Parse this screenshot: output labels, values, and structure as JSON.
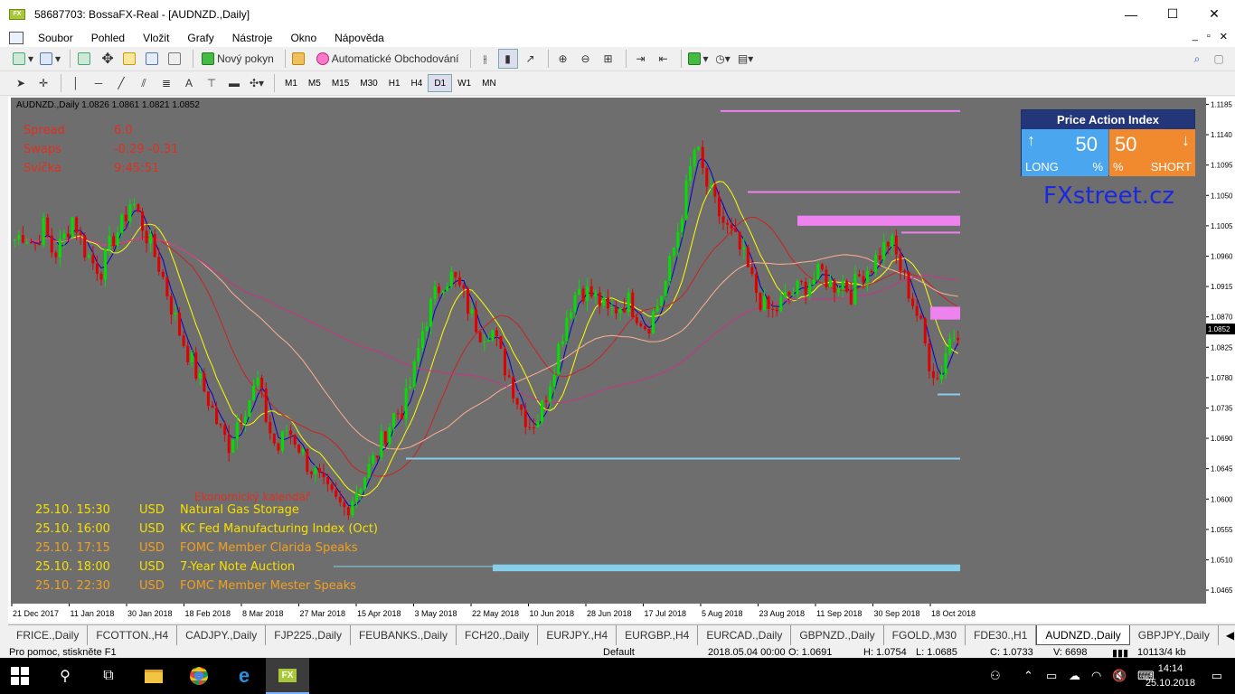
{
  "window": {
    "title": "58687703: BossaFX-Real - [AUDNZD.,Daily]",
    "icon_text": "FX",
    "minimize": "—",
    "maximize": "☐",
    "close": "✕"
  },
  "menu": {
    "items": [
      "Soubor",
      "Pohled",
      "Vložit",
      "Grafy",
      "Nástroje",
      "Okno",
      "Nápověda"
    ],
    "mdi_controls": [
      "_",
      "▫",
      "✕"
    ]
  },
  "toolbar1": {
    "new_order": "Nový pokyn",
    "auto_trading": "Automatické Obchodování"
  },
  "toolbar2": {
    "timeframes": [
      "M1",
      "M5",
      "M15",
      "M30",
      "H1",
      "H4",
      "D1",
      "W1",
      "MN"
    ],
    "active_timeframe": "D1",
    "text_tool": "A"
  },
  "chart": {
    "header": "AUDNZD.,Daily  1.0826 1.0861 1.0821 1.0852",
    "info": {
      "spread_label": "Spread",
      "spread_value": "6.0",
      "swaps_label": "Swaps",
      "swaps_value": "-0.29 -0.31",
      "candle_label": "Svíčka",
      "candle_value": "9:45:51"
    },
    "watermark": "FXstreet.cz",
    "pai": {
      "title": "Price Action Index",
      "long_value": "50",
      "long_label": "LONG",
      "short_value": "50",
      "short_label": "SHORT",
      "pct": "%"
    },
    "calendar": {
      "title": "Ekonomický kalendář",
      "rows": [
        {
          "time": "25.10. 15:30",
          "currency": "USD",
          "event": "Natural Gas Storage",
          "color": "#f5e000"
        },
        {
          "time": "25.10. 16:00",
          "currency": "USD",
          "event": "KC Fed Manufacturing Index (Oct)",
          "color": "#f5e000"
        },
        {
          "time": "25.10. 17:15",
          "currency": "USD",
          "event": "FOMC Member Clarida Speaks",
          "color": "#f0a020"
        },
        {
          "time": "25.10. 18:00",
          "currency": "USD",
          "event": "7-Year Note Auction",
          "color": "#f5e000"
        },
        {
          "time": "25.10. 22:30",
          "currency": "USD",
          "event": "FOMC Member Mester Speaks",
          "color": "#f0a020"
        }
      ]
    },
    "current_price": "1.0852"
  },
  "chart_data": {
    "type": "candlestick",
    "symbol": "AUDNZD.",
    "timeframe": "Daily",
    "ylim": [
      1.0445,
      1.1195
    ],
    "y_ticks": [
      "1.1185",
      "1.1140",
      "1.1095",
      "1.1050",
      "1.1005",
      "1.0960",
      "1.0915",
      "1.0870",
      "1.0825",
      "1.0780",
      "1.0735",
      "1.0690",
      "1.0645",
      "1.0600",
      "1.0555",
      "1.0510",
      "1.0465"
    ],
    "x_ticks": [
      "21 Dec 2017",
      "11 Jan 2018",
      "30 Jan 2018",
      "18 Feb 2018",
      "8 Mar 2018",
      "27 Mar 2018",
      "15 Apr 2018",
      "3 May 2018",
      "22 May 2018",
      "10 Jun 2018",
      "28 Jun 2018",
      "17 Jul 2018",
      "5 Aug 2018",
      "23 Aug 2018",
      "11 Sep 2018",
      "30 Sep 2018",
      "18 Oct 2018"
    ],
    "close_path": [
      1.0985,
      1.0995,
      1.0975,
      1.1005,
      1.096,
      1.0985,
      1.102,
      1.0975,
      1.095,
      1.094,
      1.0985,
      1.1005,
      1.1045,
      1.101,
      1.0975,
      1.094,
      1.089,
      1.0845,
      1.081,
      1.0775,
      1.0745,
      1.0705,
      1.068,
      1.072,
      1.0745,
      1.0775,
      1.071,
      1.067,
      1.0705,
      1.0685,
      1.0655,
      1.0635,
      1.061,
      1.0595,
      1.0585,
      1.061,
      1.0635,
      1.066,
      1.0695,
      1.0725,
      1.0735,
      1.0785,
      1.0855,
      1.0895,
      1.0925,
      1.093,
      1.0905,
      1.087,
      1.0845,
      1.0855,
      1.081,
      1.0775,
      1.0735,
      1.071,
      1.0725,
      1.0775,
      1.083,
      1.0885,
      1.0915,
      1.0905,
      1.0895,
      1.0875,
      1.0885,
      1.0895,
      1.0875,
      1.0855,
      1.0885,
      1.0925,
      1.0985,
      1.1055,
      1.1125,
      1.107,
      1.1035,
      1.1005,
      1.0985,
      1.0955,
      1.0915,
      1.0885,
      1.0875,
      1.0895,
      1.0905,
      1.0915,
      1.0925,
      1.0935,
      1.0915,
      1.0925,
      1.0905,
      1.0935,
      1.0945,
      1.0965,
      1.0985,
      1.0945,
      1.0905,
      1.0865,
      1.0805,
      1.0775,
      1.0835,
      1.0852
    ],
    "levels": [
      {
        "price": 1.1175,
        "color": "#ee82ee"
      },
      {
        "price": 1.1055,
        "color": "#ee82ee"
      },
      {
        "price": 1.0995,
        "color": "#ee82ee"
      },
      {
        "price": 1.0755,
        "color": "#87ceeb"
      },
      {
        "price": 1.066,
        "color": "#87ceeb"
      }
    ],
    "zones": [
      {
        "from": 1.1005,
        "to": 1.102,
        "color": "#ee82ee"
      },
      {
        "from": 1.0866,
        "to": 1.0885,
        "color": "#ee82ee"
      },
      {
        "from": 1.0493,
        "to": 1.0503,
        "color": "#87ceeb"
      }
    ],
    "ma_colors": [
      "#0000cc",
      "#ffff00",
      "#cc2222",
      "#ffb090",
      "#cc3388"
    ]
  },
  "tabs": {
    "items": [
      "FRICE.,Daily",
      "FCOTTON.,H4",
      "CADJPY.,Daily",
      "FJP225.,Daily",
      "FEUBANKS.,Daily",
      "FCH20.,Daily",
      "EURJPY.,H4",
      "EURGBP.,H4",
      "EURCAD.,Daily",
      "GBPNZD.,Daily",
      "FGOLD.,M30",
      "FDE30.,H1",
      "AUDNZD.,Daily",
      "GBPJPY.,Daily"
    ],
    "active": "AUDNZD.,Daily",
    "scroll_left": "◀",
    "scroll_right": "▶"
  },
  "status": {
    "help": "Pro pomoc, stiskněte F1",
    "profile": "Default",
    "datetime": "2018.05.04 00:00",
    "open": "O: 1.0691",
    "high": "H: 1.0754",
    "low": "L: 1.0685",
    "close": "C: 1.0733",
    "volume": "V: 6698",
    "traffic": "10113/4 kb"
  },
  "taskbar": {
    "time": "14:14",
    "date": "25.10.2018",
    "fx_app": "FX"
  }
}
